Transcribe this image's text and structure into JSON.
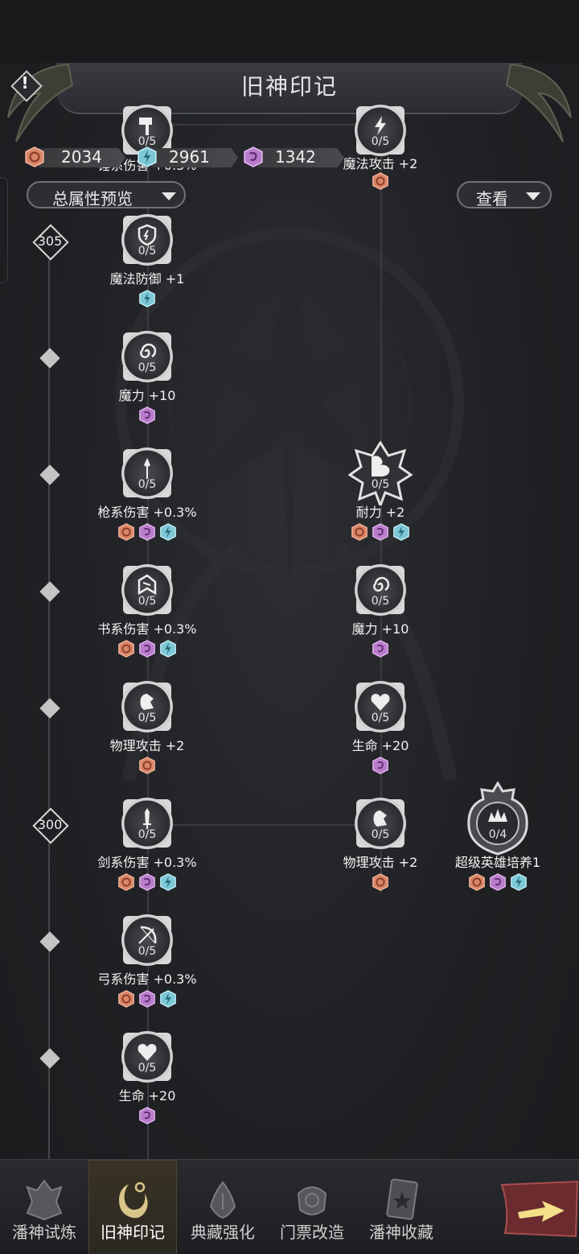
{
  "title": "旧神印记",
  "resources": [
    {
      "color": "#e08a6e",
      "value": "2034"
    },
    {
      "color": "#7ed0e0",
      "value": "2961"
    },
    {
      "color": "#c787d8",
      "value": "1342"
    }
  ],
  "filters": {
    "left": "总属性预览",
    "right": "查看"
  },
  "timeline_levels": [
    "305",
    "300"
  ],
  "nodes": [
    {
      "name": "锤系伤害 +0.3%",
      "count": "0/5",
      "icon": "hammer-icon"
    },
    {
      "name": "魔法攻击 +2",
      "count": "0/5",
      "icon": "lightning-icon"
    },
    {
      "name": "魔法防御 +1",
      "count": "0/5",
      "icon": "magic-shield-icon"
    },
    {
      "name": "魔力 +10",
      "count": "0/5",
      "icon": "spiral-icon"
    },
    {
      "name": "枪系伤害 +0.3%",
      "count": "0/5",
      "icon": "spear-icon"
    },
    {
      "name": "耐力 +2",
      "count": "0/5",
      "icon": "muscle-icon"
    },
    {
      "name": "书系伤害 +0.3%",
      "count": "0/5",
      "icon": "book-icon"
    },
    {
      "name": "魔力 +10",
      "count": "0/5",
      "icon": "spiral-icon"
    },
    {
      "name": "物理攻击 +2",
      "count": "0/5",
      "icon": "fist-icon"
    },
    {
      "name": "生命 +20",
      "count": "0/5",
      "icon": "heart-icon"
    },
    {
      "name": "剑系伤害 +0.3%",
      "count": "0/5",
      "icon": "sword-icon"
    },
    {
      "name": "物理攻击 +2",
      "count": "0/5",
      "icon": "fist-icon"
    },
    {
      "name": "超级英雄培养1",
      "count": "0/4",
      "icon": "crown-icon"
    },
    {
      "name": "弓系伤害 +0.3%",
      "count": "0/5",
      "icon": "bow-icon"
    },
    {
      "name": "生命 +20",
      "count": "0/5",
      "icon": "heart-icon"
    }
  ],
  "nav": [
    {
      "label": "潘神试炼",
      "icon": "trial-emblem-icon"
    },
    {
      "label": "旧神印记",
      "icon": "mark-emblem-icon",
      "active": true
    },
    {
      "label": "典藏强化",
      "icon": "collection-emblem-icon"
    },
    {
      "label": "门票改造",
      "icon": "ticket-emblem-icon"
    },
    {
      "label": "潘神收藏",
      "icon": "card-star-icon"
    }
  ],
  "colors": {
    "gem_orange": "#e08a6e",
    "gem_purple": "#c787d8",
    "gem_cyan": "#7ed0e0",
    "active_tab": "#d8c68a"
  }
}
